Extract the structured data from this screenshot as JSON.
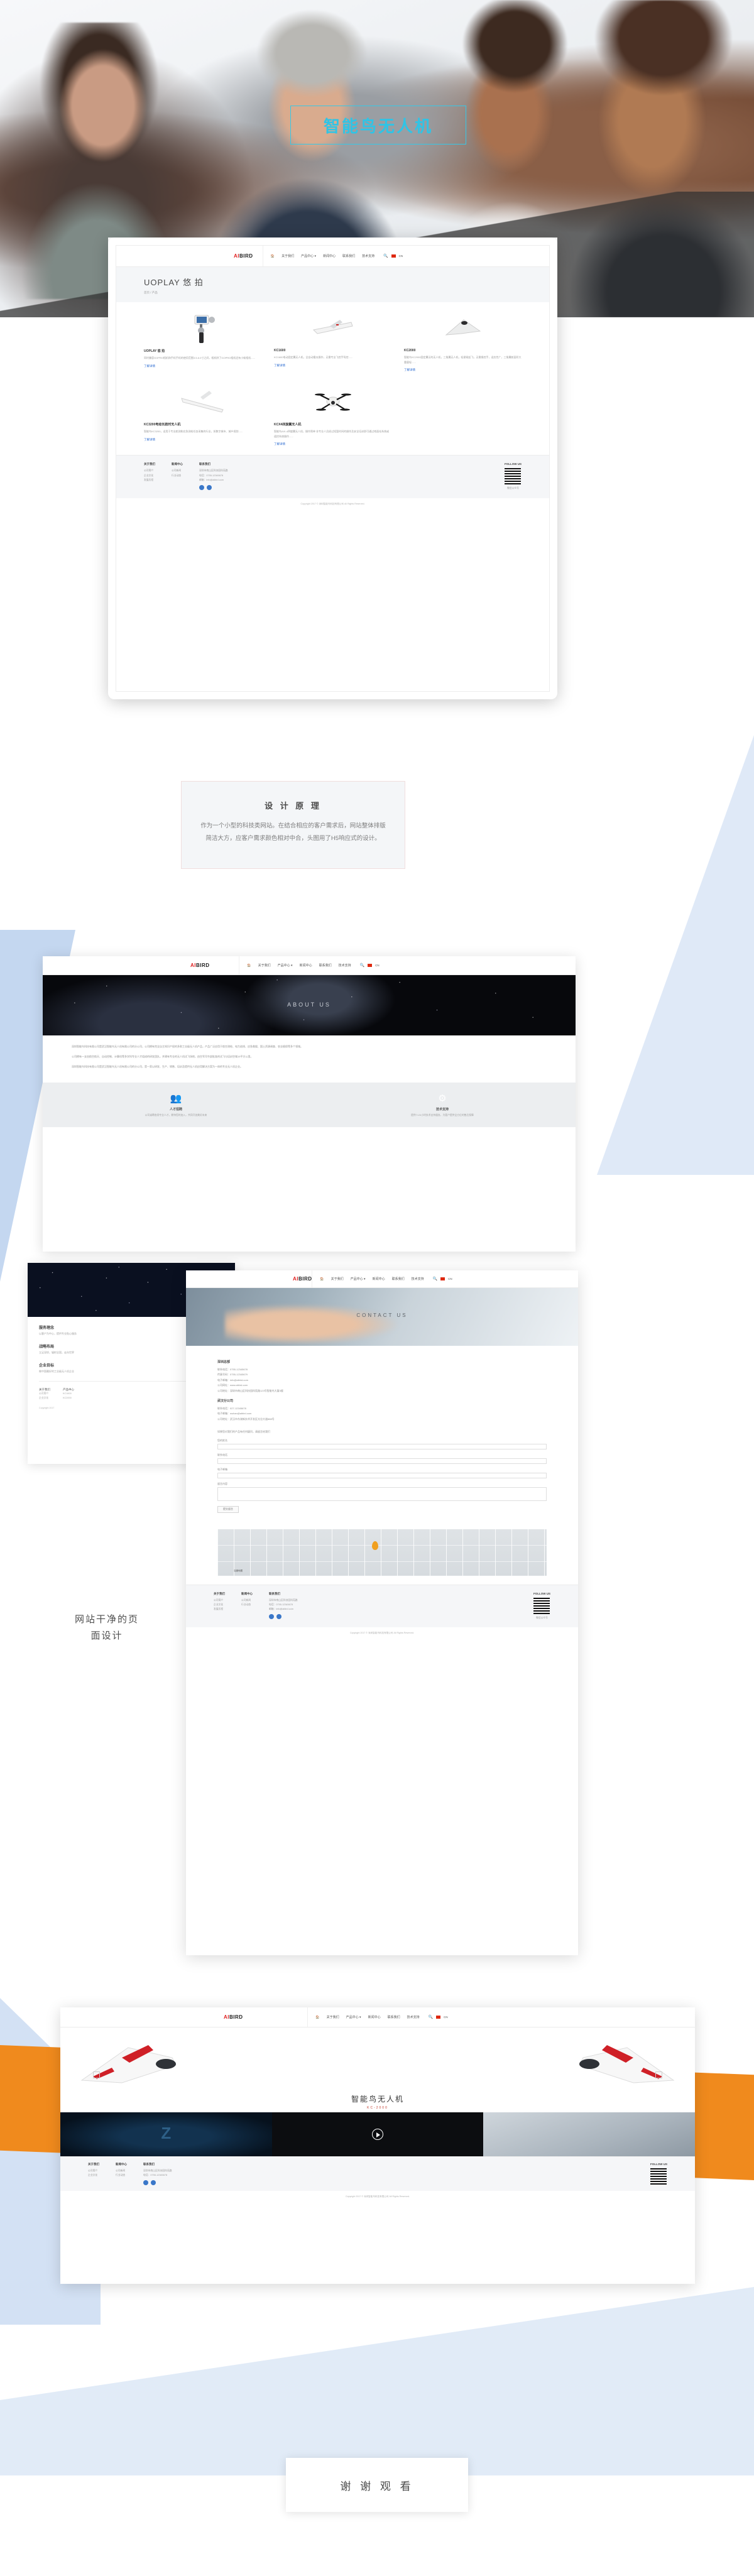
{
  "meta": {
    "brand": "AIBIRD",
    "brand_red": "AI",
    "brand_dark": "BIRD",
    "accent": "#e02020",
    "link_blue": "#2b6ad0"
  },
  "hero": {
    "title": "智能鸟无人机",
    "frame_color": "#35c8e8"
  },
  "nav": {
    "home_icon": "home-icon",
    "items": [
      "关于我们",
      "产品中心 ▾",
      "新闻中心",
      "联系我们",
      "技术支持"
    ],
    "search_icon": "search-icon",
    "lang": "CN"
  },
  "product_page": {
    "title": "UOPLAY 悠 拍",
    "breadcrumb": "首页 / 产品",
    "link_label": "了解详情",
    "products": [
      {
        "name": "UOPLAY 悠 拍",
        "desc": "同时兼容GOPRO相机和手机手机的使用范围3.5-6.0寸之间，相机除了GOPRO相机还有小蚁相机......",
        "icon": "gimbal-stabilizer"
      },
      {
        "name": "KC1600",
        "desc": "KC1600电动固定翼无人机，全自动傻瓜操作，无需专业飞控手驾控......",
        "icon": "fixed-wing-drone"
      },
      {
        "name": "KC2000",
        "desc": "智能鸟KC2000固定翼泛的无人机，三角翼无人机，轻便易起飞，无需操控手，适应性广，三角翼航面积大重量轻......",
        "icon": "delta-wing-drone"
      },
      {
        "name": "KC3200电动长航时无人机",
        "desc": "智能鸟KC3200，适用于专业航测和应急测绘任务采集的行业，如数字城市、城乡规划......",
        "icon": "long-range-drone"
      },
      {
        "name": "KCX4四旋翼无人机",
        "desc": "智能鸟AIX-4四旋翼无人机，操作简单 非专业人员经过短暂时间的操作及安全培训即可通过地面站系统或遥控系统操作......",
        "icon": "quadcopter-drone"
      }
    ]
  },
  "site_footer": {
    "columns": [
      {
        "title": "关于我们",
        "lines": [
          "公司简介",
          "企业文化",
          "发展历程"
        ]
      },
      {
        "title": "新闻中心",
        "lines": [
          "公司新闻",
          "行业动态"
        ]
      },
      {
        "title": "联系我们",
        "lines": [
          "深圳市南山区科技园科苑路",
          "电话：0755-12345678",
          "邮箱：info@aibird.com"
        ]
      },
      {
        "title": "FOLLOW US",
        "lines": [
          "微信公众号"
        ]
      }
    ],
    "copyright": "Copyright 2017 © 深圳智能鸟科技有限公司 All Rights Reserved."
  },
  "design_principle": {
    "heading": "设 计 原 理",
    "body": "作为一个小型的科技类网站。在结合相应的客户需求后，网站整体排版简洁大方，应客户需求颜色相对中合，头图用了H5响应式的设计。"
  },
  "about_page": {
    "hero_label": "ABOUT US",
    "paragraphs": [
      "深圳智能鸟科技有限公司是武汉智能鸟无人机有限公司的分公司，公司拥有完全自主知识产权的多款工业级无人机产品，产品广泛应用于航空测绘、电力巡线、应急救援、国土资源调查、农业植保等多个领域。",
      "公司拥有一支由航空航天、自动控制、计算机等多学科专业人才组成的研发团队，并建有专业的无人机试飞场地，由空军司令部批准的试飞与培训空域15平方公里。",
      "深圳智能鸟科技有限公司是武汉智能鸟无人机有限公司的分公司，是一家以研发、生产、销售、培训及提供无人机应用解决方案为一体的专业无人机企业。"
    ],
    "features": [
      {
        "icon": "people-icon",
        "title": "人才招聘",
        "desc": "公司诚聘各类专业人才，期待您的加入，共同开创美好未来"
      },
      {
        "icon": "robot-arm-icon",
        "title": "技术支持",
        "desc": "提供7×24小时技术支持服务，为客户提供全方位的售后保障"
      }
    ],
    "side_panel": {
      "items": [
        {
          "title": "服务理念",
          "desc": "以客户为中心，提供专业贴心服务"
        },
        {
          "title": "战略布局",
          "desc": "立足深圳，辐射全国，走向世界"
        },
        {
          "title": "企业目标",
          "desc": "做中国最好的工业级无人机企业"
        }
      ],
      "footer_cols": [
        {
          "title": "关于我们",
          "lines": [
            "公司简介",
            "企业文化"
          ]
        },
        {
          "title": "产品中心",
          "lines": [
            "KC1600",
            "KC2000"
          ]
        }
      ],
      "copyright": "Copyright 2017"
    }
  },
  "contact_page": {
    "hero_label": "CONTACT US",
    "sections": [
      {
        "heading": "深圳总部",
        "lines": [
          "联系电话：0755-12345678",
          "传真号码：0755-12345679",
          "电子邮箱：info@aibird.com",
          "公司网址：www.aibird.com",
          "公司地址：深圳市南山区科技园科苑路123号智能鸟大厦5楼"
        ]
      },
      {
        "heading": "武汉分公司",
        "lines": [
          "联系电话：027-12345678",
          "电子邮箱：wuhan@aibird.com",
          "公司地址：武汉市东湖新技术开发区光谷大道888号"
        ]
      }
    ],
    "form": {
      "intro": "如果您对我们的产品有任何疑问，请留言给我们",
      "fields": [
        {
          "label": "您的姓名",
          "type": "line"
        },
        {
          "label": "联系电话",
          "type": "line"
        },
        {
          "label": "电子邮箱",
          "type": "line"
        },
        {
          "label": "留言内容",
          "type": "area"
        }
      ],
      "submit_label": "提交留言"
    },
    "map": {
      "pin_label": "map-pin",
      "attribution": "百度地图"
    }
  },
  "product_detail": {
    "title": "智能鸟无人机",
    "subtitle": "KC-2000",
    "prev_icon": "arrow-left-icon",
    "next_icon": "arrow-right-icon",
    "play_icon": "play-icon",
    "tiles": [
      "dark-hangar-photo",
      "video-player",
      "workshop-photo"
    ]
  },
  "thanks": {
    "label": "谢 谢 观 看"
  }
}
